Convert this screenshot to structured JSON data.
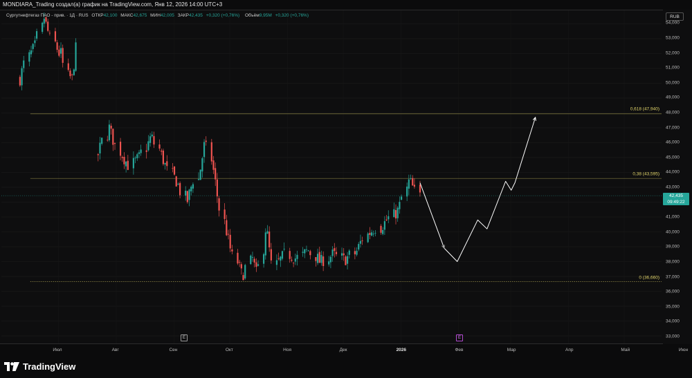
{
  "header": {
    "attribution": "MONDIARA_Trading создал(а) график на TradingView.com, Янв 12, 2026 14:00 UTC+3"
  },
  "legend": {
    "symbol": "Сургутнефтегаз ПАО - прив. · 1Д · RUS",
    "open_label": "ОТКР",
    "open": "42,100",
    "high_label": "МАКС",
    "high": "42,675",
    "low_label": "МИН",
    "low": "42,005",
    "close_label": "ЗАКР",
    "close": "42,435",
    "change": "+0,320 (+0,76%)",
    "volume_label": "Объём",
    "volume": "9,95M",
    "volume_change": "+0,320 (+0,76%)"
  },
  "axis": {
    "currency": "RUB",
    "price_ticks": [
      "54,000",
      "53,000",
      "52,000",
      "51,000",
      "50,000",
      "49,000",
      "48,000",
      "47,000",
      "46,000",
      "45,000",
      "44,000",
      "43,000",
      "42,000",
      "41,000",
      "40,000",
      "39,000",
      "38,000",
      "37,000",
      "36,000",
      "35,000",
      "34,000",
      "33,000"
    ],
    "months": [
      "Июл",
      "Авг",
      "Сен",
      "Окт",
      "Ноя",
      "Дек",
      "2026",
      "Фев",
      "Мар",
      "Апр",
      "Май",
      "Июн"
    ]
  },
  "price_tag": {
    "price": "42,435",
    "countdown": "09:49:22"
  },
  "fib_levels": [
    {
      "label": "0,618 (47,940)",
      "price": 47.94
    },
    {
      "label": "0,38 (43,595)",
      "price": 43.595
    },
    {
      "label": "0 (36,660)",
      "price": 36.66
    }
  ],
  "events": [
    {
      "label": "E",
      "style": "normal"
    },
    {
      "label": "E",
      "style": "purple"
    }
  ],
  "logo": {
    "text": "TradingView",
    "icon": "tradingview-logo-icon"
  },
  "colors": {
    "up": "#26a69a",
    "down": "#ef5350",
    "fib": "#e3d66b",
    "projection": "#ffffff",
    "background": "#0e0e0f"
  },
  "chart_data": {
    "type": "candlestick",
    "ylim": [
      33,
      54.3
    ],
    "current_price": 42.435,
    "projection_path": [
      {
        "date": "2026-01-12",
        "value": 43.3
      },
      {
        "date": "2026-01-25",
        "value": 38.9
      },
      {
        "date": "2026-02-01",
        "value": 38.0
      },
      {
        "date": "2026-02-12",
        "value": 40.8
      },
      {
        "date": "2026-02-17",
        "value": 40.2
      },
      {
        "date": "2026-02-27",
        "value": 43.4
      },
      {
        "date": "2026-03-02",
        "value": 42.8
      },
      {
        "date": "2026-03-04",
        "value": 43.3
      },
      {
        "date": "2026-03-15",
        "value": 47.7
      }
    ],
    "segments": [
      {
        "from": "2025-06-11",
        "to": "2025-07-02",
        "anchors": [
          50.3,
          51.8,
          52.5,
          54.4,
          53.0,
          52.0
        ]
      },
      {
        "from": "2025-07-03",
        "to": "2025-07-12",
        "anchors": [
          52.0,
          50.5,
          50.3,
          52.3
        ]
      },
      {
        "from": "2025-07-23",
        "to": "2025-08-20",
        "anchors": [
          45.2,
          47.0,
          45.4,
          44.5,
          45.0,
          46.3
        ]
      },
      {
        "from": "2025-08-21",
        "to": "2025-09-14",
        "anchors": [
          46.3,
          45.1,
          44.0,
          43.3,
          42.0,
          43.5
        ]
      },
      {
        "from": "2025-09-15",
        "to": "2025-10-08",
        "anchors": [
          43.5,
          46.1,
          43.5,
          40.5,
          38.5,
          37.2
        ]
      },
      {
        "from": "2025-10-09",
        "to": "2025-10-24",
        "anchors": [
          37.2,
          38.3,
          37.0,
          40.5,
          37.8
        ]
      },
      {
        "from": "2025-10-25",
        "to": "2025-11-19",
        "anchors": [
          37.8,
          38.5,
          38.2,
          38.8,
          38.0
        ]
      },
      {
        "from": "2025-11-20",
        "to": "2025-12-20",
        "anchors": [
          38.0,
          38.5,
          38.1,
          38.6,
          39.8,
          40.3
        ]
      },
      {
        "from": "2025-12-21",
        "to": "2026-01-12",
        "anchors": [
          40.3,
          40.9,
          41.5,
          43.5,
          42.43
        ]
      }
    ]
  }
}
